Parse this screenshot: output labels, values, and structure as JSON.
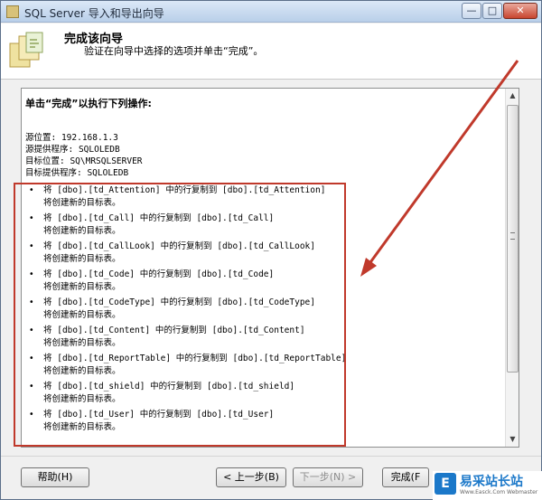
{
  "window": {
    "title": "SQL Server 导入和导出向导",
    "min_glyph": "—",
    "max_glyph": "□",
    "close_glyph": "✕"
  },
  "header": {
    "title": "完成该向导",
    "subtitle": "验证在向导中选择的选项并单击“完成”。"
  },
  "summary": {
    "heading": "单击“完成”以执行下列操作:",
    "info": [
      "源位置: 192.168.1.3",
      "源提供程序: SQLOLEDB",
      "目标位置: SQ\\MRSQLSERVER",
      "目标提供程序: SQLOLEDB"
    ],
    "operations": [
      {
        "main": "将 [dbo].[td_Attention] 中的行复制到 [dbo].[td_Attention]",
        "sub": "将创建新的目标表。"
      },
      {
        "main": "将 [dbo].[td_Call] 中的行复制到 [dbo].[td_Call]",
        "sub": "将创建新的目标表。"
      },
      {
        "main": "将 [dbo].[td_CallLook] 中的行复制到 [dbo].[td_CallLook]",
        "sub": "将创建新的目标表。"
      },
      {
        "main": "将 [dbo].[td_Code] 中的行复制到 [dbo].[td_Code]",
        "sub": "将创建新的目标表。"
      },
      {
        "main": "将 [dbo].[td_CodeType] 中的行复制到 [dbo].[td_CodeType]",
        "sub": "将创建新的目标表。"
      },
      {
        "main": "将 [dbo].[td_Content] 中的行复制到 [dbo].[td_Content]",
        "sub": "将创建新的目标表。"
      },
      {
        "main": "将 [dbo].[td_ReportTable] 中的行复制到 [dbo].[td_ReportTable]",
        "sub": "将创建新的目标表。"
      },
      {
        "main": "将 [dbo].[td_shield] 中的行复制到 [dbo].[td_shield]",
        "sub": "将创建新的目标表。"
      },
      {
        "main": "将 [dbo].[td_User] 中的行复制到 [dbo].[td_User]",
        "sub": "将创建新的目标表。"
      }
    ]
  },
  "buttons": {
    "help": "帮助(H)",
    "back": "< 上一步(B)",
    "next": "下一步(N) >",
    "finish": "完成(F"
  },
  "watermark": {
    "logo": "E",
    "text": "易采站长站",
    "sub": "Www.Easck.Com Webmaster"
  },
  "colors": {
    "highlight": "#c0392b",
    "accent": "#1b78c9"
  }
}
